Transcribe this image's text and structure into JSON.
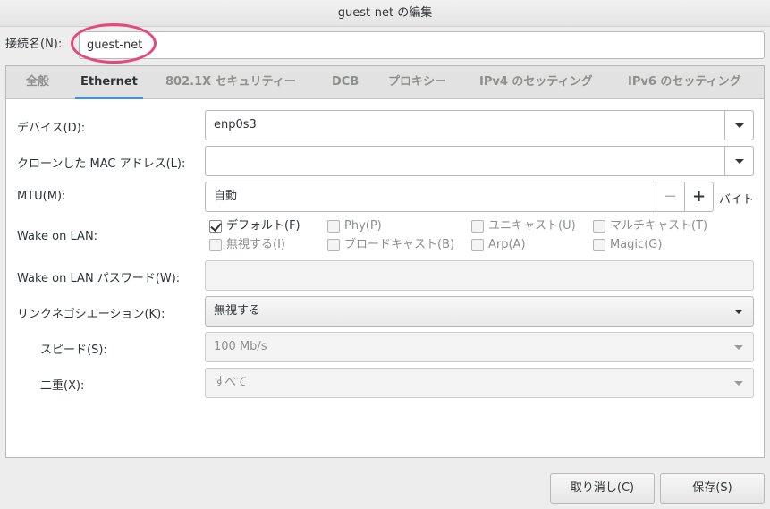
{
  "window": {
    "title": "guest-net の編集"
  },
  "connection": {
    "label": "接続名(N):",
    "value": "guest-net"
  },
  "tabs": [
    {
      "label": "全般"
    },
    {
      "label": "Ethernet"
    },
    {
      "label": "802.1X セキュリティー"
    },
    {
      "label": "DCB"
    },
    {
      "label": "プロキシー"
    },
    {
      "label": "IPv4 のセッティング"
    },
    {
      "label": "IPv6 のセッティング"
    }
  ],
  "ethernet": {
    "device": {
      "label": "デバイス(D):",
      "value": "enp0s3"
    },
    "cloned_mac": {
      "label": "クローンした MAC アドレス(L):",
      "value": ""
    },
    "mtu": {
      "label": "MTU(M):",
      "value": "自動",
      "minus": "−",
      "plus": "+",
      "unit": "バイト"
    },
    "wol": {
      "label": "Wake on LAN:",
      "options": [
        {
          "label": "デフォルト(F)",
          "checked": true
        },
        {
          "label": "Phy(P)",
          "checked": false
        },
        {
          "label": "ユニキャスト(U)",
          "checked": false
        },
        {
          "label": "マルチキャスト(T)",
          "checked": false
        },
        {
          "label": "無視する(I)",
          "checked": false
        },
        {
          "label": "ブロードキャスト(B)",
          "checked": false
        },
        {
          "label": "Arp(A)",
          "checked": false
        },
        {
          "label": "Magic(G)",
          "checked": false
        }
      ]
    },
    "wol_password": {
      "label": "Wake on LAN パスワード(W):",
      "value": ""
    },
    "negotiation": {
      "label": "リンクネゴシエーション(K):",
      "value": "無視する"
    },
    "speed": {
      "label": "スピード(S):",
      "value": "100 Mb/s"
    },
    "duplex": {
      "label": "二重(X):",
      "value": "すべて"
    }
  },
  "buttons": {
    "cancel": "取り消し(C)",
    "save": "保存(S)"
  },
  "colors": {
    "accent": "#4a90d9",
    "highlight_ring": "#e8467f"
  }
}
